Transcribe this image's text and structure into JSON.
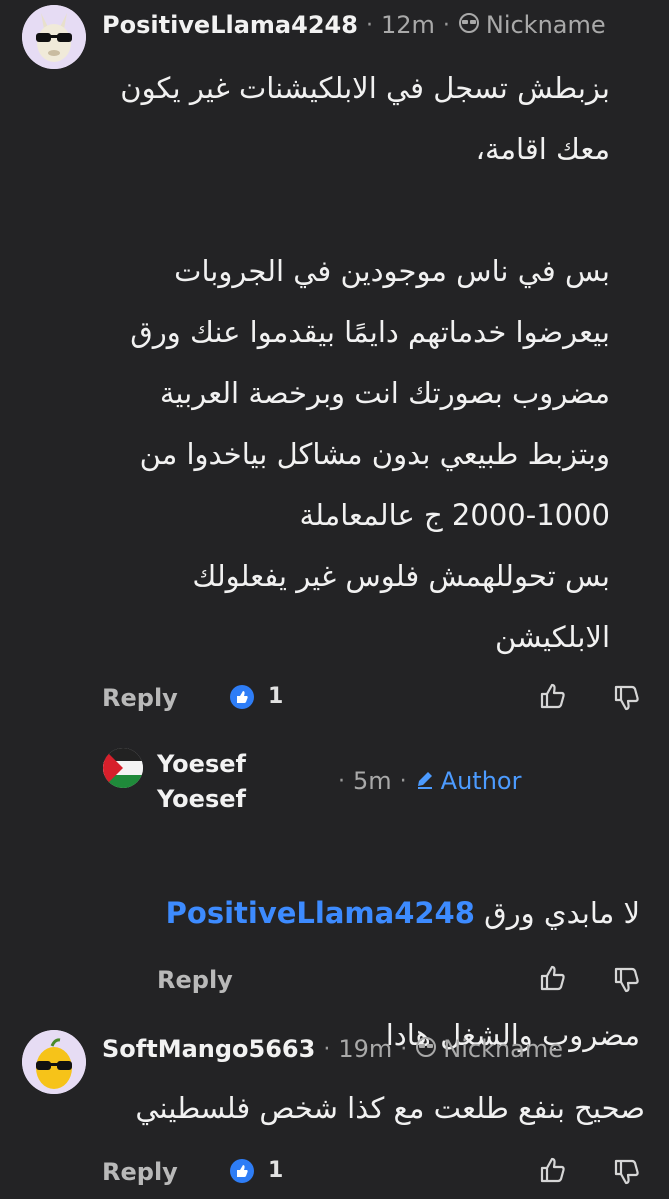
{
  "comments": [
    {
      "username": "PositiveLlama4248",
      "time": "12m",
      "tag": "Nickname",
      "tag_icon": "sunglasses-face-icon",
      "avatar": "llama-with-sunglasses",
      "body": "بزبطش تسجل في الابلكيشنات غير يكون\nمعك اقامة،\n\nبس في ناس موجودين في الجروبات\nبيعرضوا خدماتهم دايمًا بيقدموا عنك ورق\nمضروب بصورتك انت وبرخصة العربية\nوبتزبط طبيعي بدون مشاكل بياخدوا من\n2000-1000 ج عالمعاملة\nبس تحوللهمش فلوس غير يفعلولك\nالابلكيشن",
      "reply_label": "Reply",
      "upvote_count": "1"
    },
    {
      "username": "Yoesef\nYoesef",
      "time": "5m",
      "tag": "Author",
      "tag_icon": "pencil-icon",
      "avatar": "palestine-flag",
      "mention": "PositiveLlama4248",
      "body_after_mention": "لا مابدي ورق",
      "body_line2": "مضروب والشغل هادا",
      "reply_label": "Reply"
    },
    {
      "username": "SoftMango5663",
      "time": "19m",
      "tag": "Nickname",
      "tag_icon": "sunglasses-face-icon",
      "avatar": "mango-with-sunglasses",
      "body": "صحيح بنفع طلعت مع كذا شخص فلسطيني",
      "reply_label": "Reply",
      "upvote_count": "1"
    }
  ],
  "colors": {
    "background": "#232325",
    "author": "#4c9bff",
    "mention": "#3d8bff",
    "upvote": "#2e7df6"
  }
}
